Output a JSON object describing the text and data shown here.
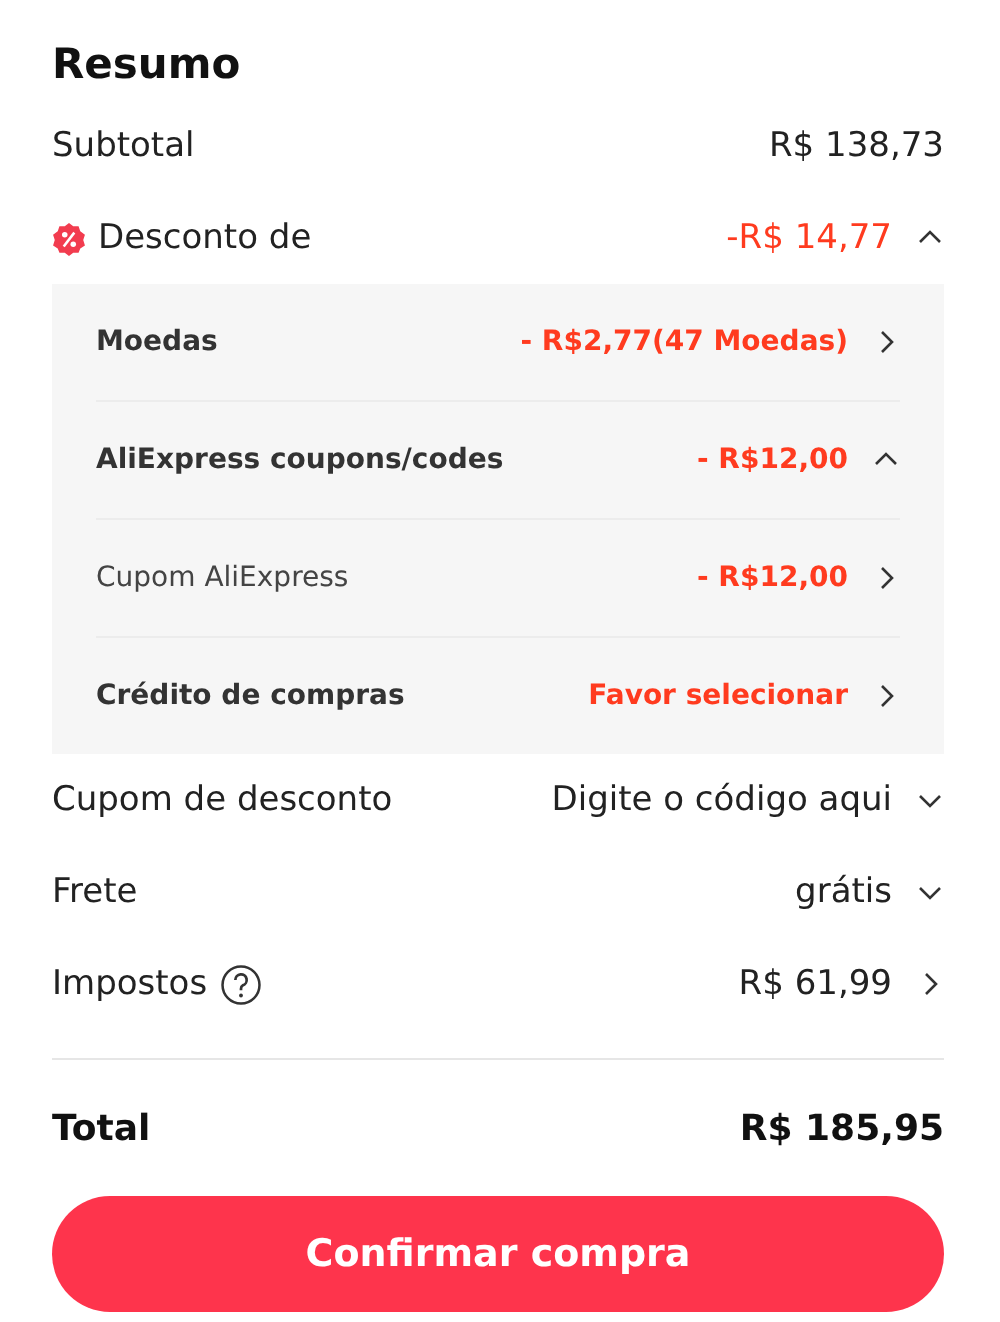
{
  "title": "Resumo",
  "subtotal": {
    "label": "Subtotal",
    "value": "R$ 138,73"
  },
  "discount": {
    "label": "Desconto de",
    "value": "-R$ 14,77",
    "expanded": true,
    "items": [
      {
        "label": "Moedas",
        "value": "- R$2,77(47 Moedas)",
        "bold": true,
        "kind": "right"
      },
      {
        "label": "AliExpress coupons/codes",
        "value": "- R$12,00",
        "bold": true,
        "kind": "up"
      },
      {
        "label": "Cupom AliExpress",
        "value": "- R$12,00",
        "bold": false,
        "kind": "right"
      },
      {
        "label": "Crédito de compras",
        "value": "Favor selecionar",
        "bold": true,
        "kind": "right"
      }
    ]
  },
  "rows": [
    {
      "label": "Cupom de desconto",
      "value": "Digite o código aqui",
      "kind": "down",
      "help": false
    },
    {
      "label": "Frete",
      "value": "grátis",
      "kind": "down",
      "help": false
    },
    {
      "label": "Impostos",
      "value": "R$ 61,99",
      "kind": "right",
      "help": true
    }
  ],
  "total": {
    "label": "Total",
    "value": "R$ 185,95"
  },
  "confirm_button": "Confirmar compra"
}
